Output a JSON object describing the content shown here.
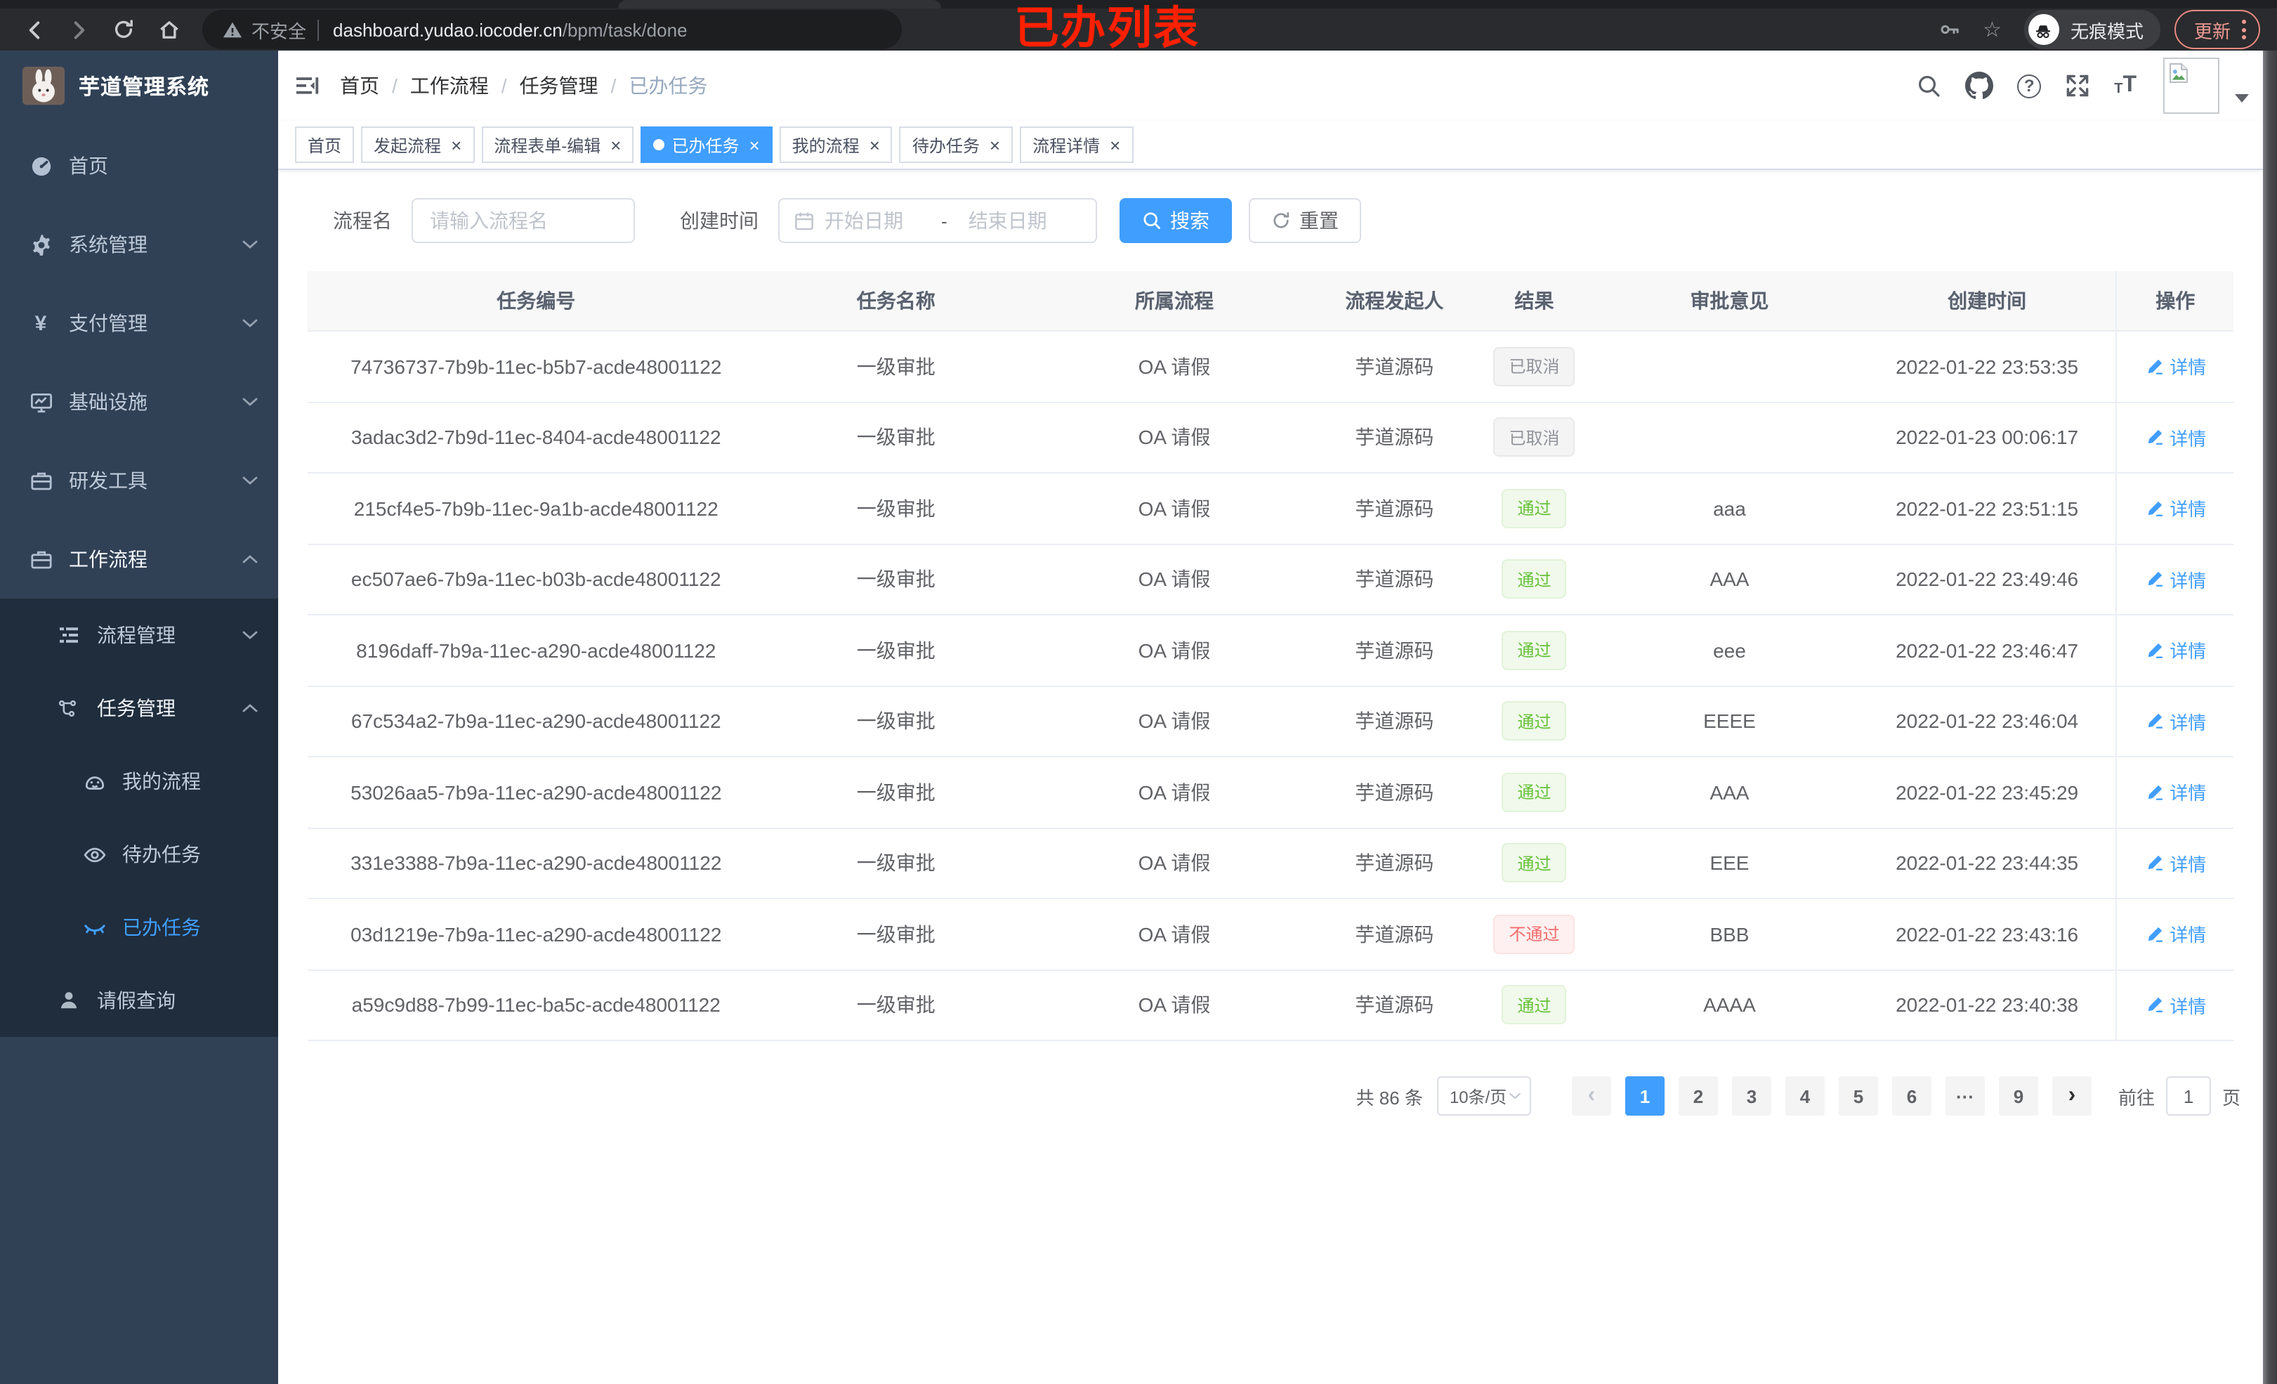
{
  "annotation": "已办列表",
  "browser": {
    "insecure_label": "不安全",
    "url_host": "dashboard.yudao.iocoder.cn",
    "url_path": "/bpm/task/done",
    "incognito_label": "无痕模式",
    "update_label": "更新"
  },
  "app": {
    "title": "芋道管理系统"
  },
  "sidebar": {
    "items": [
      {
        "label": "首页",
        "icon": "dashboard",
        "level": 1
      },
      {
        "label": "系统管理",
        "icon": "gear",
        "level": 1,
        "chevron": "down"
      },
      {
        "label": "支付管理",
        "icon": "yen",
        "level": 1,
        "chevron": "down"
      },
      {
        "label": "基础设施",
        "icon": "monitor",
        "level": 1,
        "chevron": "down"
      },
      {
        "label": "研发工具",
        "icon": "briefcase",
        "level": 1,
        "chevron": "down"
      },
      {
        "label": "工作流程",
        "icon": "briefcase",
        "level": 1,
        "chevron": "up",
        "open": true
      },
      {
        "label": "流程管理",
        "icon": "tree",
        "level": 2,
        "chevron": "down",
        "dark": true
      },
      {
        "label": "任务管理",
        "icon": "flow",
        "level": 2,
        "chevron": "up",
        "open": true,
        "dark": true
      },
      {
        "label": "我的流程",
        "icon": "face",
        "level": 3,
        "dark": true
      },
      {
        "label": "待办任务",
        "icon": "eye",
        "level": 3,
        "dark": true
      },
      {
        "label": "已办任务",
        "icon": "eyeclosed",
        "level": 3,
        "dark": true,
        "active": true
      },
      {
        "label": "请假查询",
        "icon": "user",
        "level": 2,
        "dark": true
      }
    ]
  },
  "breadcrumb": {
    "items": [
      "首页",
      "工作流程",
      "任务管理",
      "已办任务"
    ]
  },
  "tags": {
    "items": [
      {
        "label": "首页",
        "closable": false,
        "active": false
      },
      {
        "label": "发起流程",
        "closable": true,
        "active": false
      },
      {
        "label": "流程表单-编辑",
        "closable": true,
        "active": false
      },
      {
        "label": "已办任务",
        "closable": true,
        "active": true
      },
      {
        "label": "我的流程",
        "closable": true,
        "active": false
      },
      {
        "label": "待办任务",
        "closable": true,
        "active": false
      },
      {
        "label": "流程详情",
        "closable": true,
        "active": false
      }
    ]
  },
  "filters": {
    "name_label": "流程名",
    "name_placeholder": "请输入流程名",
    "date_label": "创建时间",
    "date_start_placeholder": "开始日期",
    "date_separator": "-",
    "date_end_placeholder": "结束日期",
    "search_label": "搜索",
    "reset_label": "重置"
  },
  "table": {
    "columns": [
      "任务编号",
      "任务名称",
      "所属流程",
      "流程发起人",
      "结果",
      "审批意见",
      "创建时间",
      "操作"
    ],
    "action_label": "详情",
    "rows": [
      {
        "id": "74736737-7b9b-11ec-b5b7-acde48001122",
        "name": "一级审批",
        "process": "OA 请假",
        "starter": "芋道源码",
        "result": "已取消",
        "result_type": "info",
        "comment": "",
        "created": "2022-01-22 23:53:35"
      },
      {
        "id": "3adac3d2-7b9d-11ec-8404-acde48001122",
        "name": "一级审批",
        "process": "OA 请假",
        "starter": "芋道源码",
        "result": "已取消",
        "result_type": "info",
        "comment": "",
        "created": "2022-01-23 00:06:17"
      },
      {
        "id": "215cf4e5-7b9b-11ec-9a1b-acde48001122",
        "name": "一级审批",
        "process": "OA 请假",
        "starter": "芋道源码",
        "result": "通过",
        "result_type": "success",
        "comment": "aaa",
        "created": "2022-01-22 23:51:15"
      },
      {
        "id": "ec507ae6-7b9a-11ec-b03b-acde48001122",
        "name": "一级审批",
        "process": "OA 请假",
        "starter": "芋道源码",
        "result": "通过",
        "result_type": "success",
        "comment": "AAA",
        "created": "2022-01-22 23:49:46"
      },
      {
        "id": "8196daff-7b9a-11ec-a290-acde48001122",
        "name": "一级审批",
        "process": "OA 请假",
        "starter": "芋道源码",
        "result": "通过",
        "result_type": "success",
        "comment": "eee",
        "created": "2022-01-22 23:46:47"
      },
      {
        "id": "67c534a2-7b9a-11ec-a290-acde48001122",
        "name": "一级审批",
        "process": "OA 请假",
        "starter": "芋道源码",
        "result": "通过",
        "result_type": "success",
        "comment": "EEEE",
        "created": "2022-01-22 23:46:04"
      },
      {
        "id": "53026aa5-7b9a-11ec-a290-acde48001122",
        "name": "一级审批",
        "process": "OA 请假",
        "starter": "芋道源码",
        "result": "通过",
        "result_type": "success",
        "comment": "AAA",
        "created": "2022-01-22 23:45:29"
      },
      {
        "id": "331e3388-7b9a-11ec-a290-acde48001122",
        "name": "一级审批",
        "process": "OA 请假",
        "starter": "芋道源码",
        "result": "通过",
        "result_type": "success",
        "comment": "EEE",
        "created": "2022-01-22 23:44:35"
      },
      {
        "id": "03d1219e-7b9a-11ec-a290-acde48001122",
        "name": "一级审批",
        "process": "OA 请假",
        "starter": "芋道源码",
        "result": "不通过",
        "result_type": "danger",
        "comment": "BBB",
        "created": "2022-01-22 23:43:16"
      },
      {
        "id": "a59c9d88-7b99-11ec-ba5c-acde48001122",
        "name": "一级审批",
        "process": "OA 请假",
        "starter": "芋道源码",
        "result": "通过",
        "result_type": "success",
        "comment": "AAAA",
        "created": "2022-01-22 23:40:38"
      }
    ]
  },
  "pagination": {
    "total_label": "共 86 条",
    "page_size_label": "10条/页",
    "pages": [
      {
        "type": "prev",
        "label": "‹"
      },
      {
        "type": "page",
        "label": "1",
        "active": true
      },
      {
        "type": "page",
        "label": "2"
      },
      {
        "type": "page",
        "label": "3"
      },
      {
        "type": "page",
        "label": "4"
      },
      {
        "type": "page",
        "label": "5"
      },
      {
        "type": "page",
        "label": "6"
      },
      {
        "type": "ellipsis",
        "label": "···"
      },
      {
        "type": "page",
        "label": "9"
      },
      {
        "type": "next",
        "label": "›"
      }
    ],
    "goto_label": "前往",
    "goto_value": "1",
    "goto_unit": "页"
  }
}
